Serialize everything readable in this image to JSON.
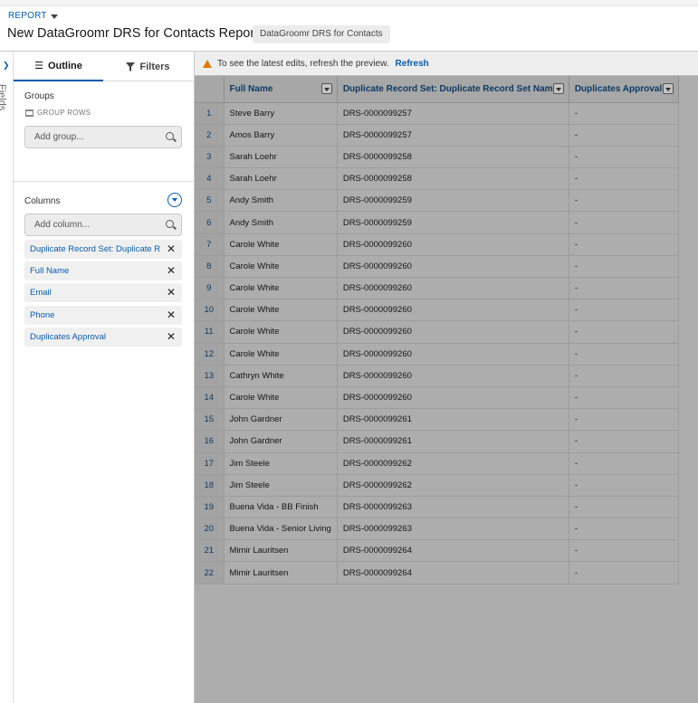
{
  "header": {
    "breadcrumb": "REPORT",
    "title": "New DataGroomr DRS for Contacts Report",
    "report_type": "DataGroomr DRS for Contacts"
  },
  "fields_rail": {
    "label": "Fields"
  },
  "tabs": {
    "outline": "Outline",
    "filters": "Filters"
  },
  "groups": {
    "label": "Groups",
    "group_rows": "GROUP ROWS",
    "add_placeholder": "Add group..."
  },
  "columns": {
    "label": "Columns",
    "add_placeholder": "Add column...",
    "items": [
      "Duplicate Record Set: Duplicate R",
      "Full Name",
      "Email",
      "Phone",
      "Duplicates Approval"
    ]
  },
  "banner": {
    "message": "To see the latest edits, refresh the preview.",
    "refresh": "Refresh"
  },
  "table": {
    "headers": [
      "Full Name",
      "Duplicate Record Set: Duplicate Record Set Name",
      "Duplicates Approval"
    ],
    "rows": [
      {
        "n": "1",
        "name": "Steve Barry",
        "drs": "DRS-0000099257",
        "approval": "-"
      },
      {
        "n": "2",
        "name": "Amos Barry",
        "drs": "DRS-0000099257",
        "approval": "-"
      },
      {
        "n": "3",
        "name": "Sarah Loehr",
        "drs": "DRS-0000099258",
        "approval": "-"
      },
      {
        "n": "4",
        "name": "Sarah Loehr",
        "drs": "DRS-0000099258",
        "approval": "-"
      },
      {
        "n": "5",
        "name": "Andy Smith",
        "drs": "DRS-0000099259",
        "approval": "-"
      },
      {
        "n": "6",
        "name": "Andy Smith",
        "drs": "DRS-0000099259",
        "approval": "-"
      },
      {
        "n": "7",
        "name": "Carole White",
        "drs": "DRS-0000099260",
        "approval": "-"
      },
      {
        "n": "8",
        "name": "Carole White",
        "drs": "DRS-0000099260",
        "approval": "-"
      },
      {
        "n": "9",
        "name": "Carole White",
        "drs": "DRS-0000099260",
        "approval": "-"
      },
      {
        "n": "10",
        "name": "Carole White",
        "drs": "DRS-0000099260",
        "approval": "-"
      },
      {
        "n": "11",
        "name": "Carole White",
        "drs": "DRS-0000099260",
        "approval": "-"
      },
      {
        "n": "12",
        "name": "Carole White",
        "drs": "DRS-0000099260",
        "approval": "-"
      },
      {
        "n": "13",
        "name": "Cathryn White",
        "drs": "DRS-0000099260",
        "approval": "-"
      },
      {
        "n": "14",
        "name": "Carole White",
        "drs": "DRS-0000099260",
        "approval": "-"
      },
      {
        "n": "15",
        "name": "John Gardner",
        "drs": "DRS-0000099261",
        "approval": "-"
      },
      {
        "n": "16",
        "name": "John Gardner",
        "drs": "DRS-0000099261",
        "approval": "-"
      },
      {
        "n": "17",
        "name": "Jim Steele",
        "drs": "DRS-0000099262",
        "approval": "-"
      },
      {
        "n": "18",
        "name": "Jim Steele",
        "drs": "DRS-0000099262",
        "approval": "-"
      },
      {
        "n": "19",
        "name": "Buena Vida - BB Finish",
        "drs": "DRS-0000099263",
        "approval": "-"
      },
      {
        "n": "20",
        "name": "Buena Vida - Senior Living",
        "drs": "DRS-0000099263",
        "approval": "-"
      },
      {
        "n": "21",
        "name": "Mimir Lauritsen",
        "drs": "DRS-0000099264",
        "approval": "-"
      },
      {
        "n": "22",
        "name": "Mimir Lauritsen",
        "drs": "DRS-0000099264",
        "approval": "-"
      }
    ]
  }
}
